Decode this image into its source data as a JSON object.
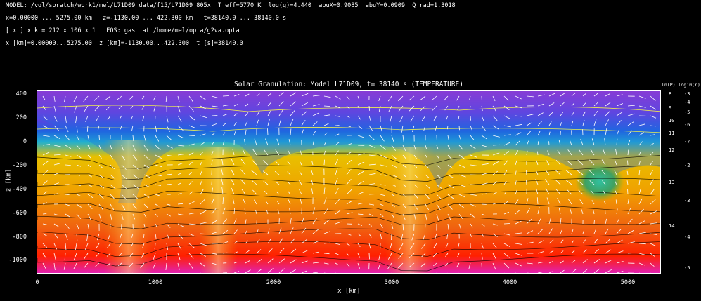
{
  "header": {
    "line1": "MODEL: /vol/soratch/work1/mel/L71D09_data/f15/L71D09_805x  T_eff=5770 K  log(g)=4.440  abuX=0.9085  abuY=0.0909  Q_rad=1.3018",
    "line2": "x=0.00000 ... 5275.00 km   z=-1130.00 ... 422.300 km   t=38140.0 ... 38140.0 s",
    "line3": "[ x ] x k = 212 x 106 x 1   EOS: gas  at /home/mel/opta/g2va.opta",
    "line4": "x [km]=0.00000...5275.00  z [km]=-1130.00...422.300  t [s]=38140.0"
  },
  "plot": {
    "title": "Solar Granulation: Model L71D09, t= 38140 s   (TEMPERATURE)",
    "x_label": "x [km]",
    "y_label": "z [km]",
    "x_ticks": [
      "0",
      "1000",
      "2000",
      "3000",
      "4000",
      "5000"
    ],
    "y_ticks": [
      "400",
      "200",
      "0",
      "-200",
      "-400",
      "-600",
      "-800",
      "-1000"
    ],
    "right_axis_header": "ln(P) log10(r)",
    "right_ticks_a": [
      "8",
      "9",
      "10",
      "11",
      "12",
      "13",
      "14"
    ],
    "right_ticks_b": [
      "-3",
      "-4",
      "-5",
      "-6",
      "-7",
      "-2",
      "-3",
      "-4",
      "-5"
    ]
  },
  "colors": {
    "hot": "#ff1e00",
    "warm": "#e8b000",
    "cool": "#1a9fd0",
    "cold": "#a020c0",
    "background": "#000000",
    "contour": "#000000",
    "isoline_yellow": "#ffff40",
    "arrow": "#ffffff"
  },
  "image": {
    "description_icon": "solar-granulation-temperature-field"
  }
}
